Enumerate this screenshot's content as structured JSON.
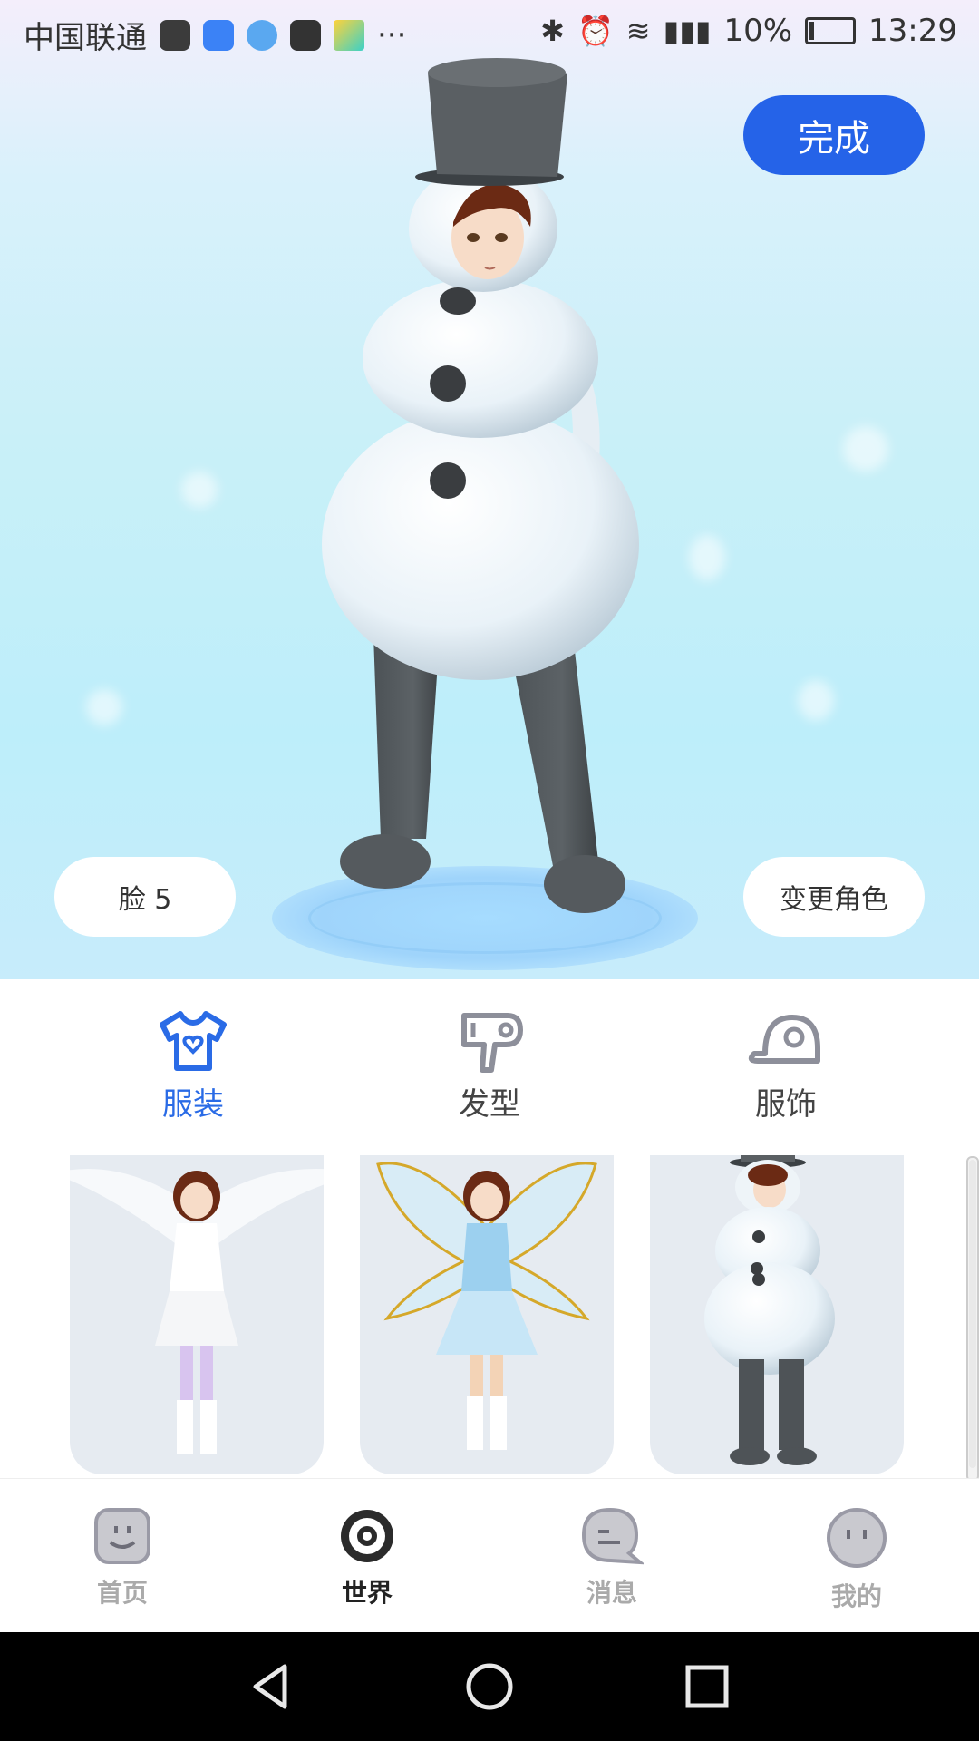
{
  "status_bar": {
    "carrier": "中国联通",
    "more_indicator": "···",
    "battery": "10%",
    "time": "13:29"
  },
  "header": {
    "done_label": "完成"
  },
  "avatar_controls": {
    "face_label": "脸 5",
    "change_role_label": "变更角色"
  },
  "categories": [
    {
      "label": "服装",
      "icon": "t-shirt-icon",
      "active": true
    },
    {
      "label": "发型",
      "icon": "hair-dryer-icon",
      "active": false
    },
    {
      "label": "服饰",
      "icon": "cap-icon",
      "active": false
    }
  ],
  "outfits": [
    {
      "name": "angel-outfit"
    },
    {
      "name": "fairy-outfit"
    },
    {
      "name": "snowman-outfit"
    }
  ],
  "bottom_nav": [
    {
      "label": "首页",
      "icon": "home-face-icon",
      "active": false
    },
    {
      "label": "世界",
      "icon": "world-target-icon",
      "active": true
    },
    {
      "label": "消息",
      "icon": "message-bubble-icon",
      "active": false
    },
    {
      "label": "我的",
      "icon": "profile-face-icon",
      "active": false
    }
  ],
  "colors": {
    "accent": "#2563e8",
    "active_tab": "#2a6be6",
    "inactive_icon": "#9a9aa6"
  }
}
